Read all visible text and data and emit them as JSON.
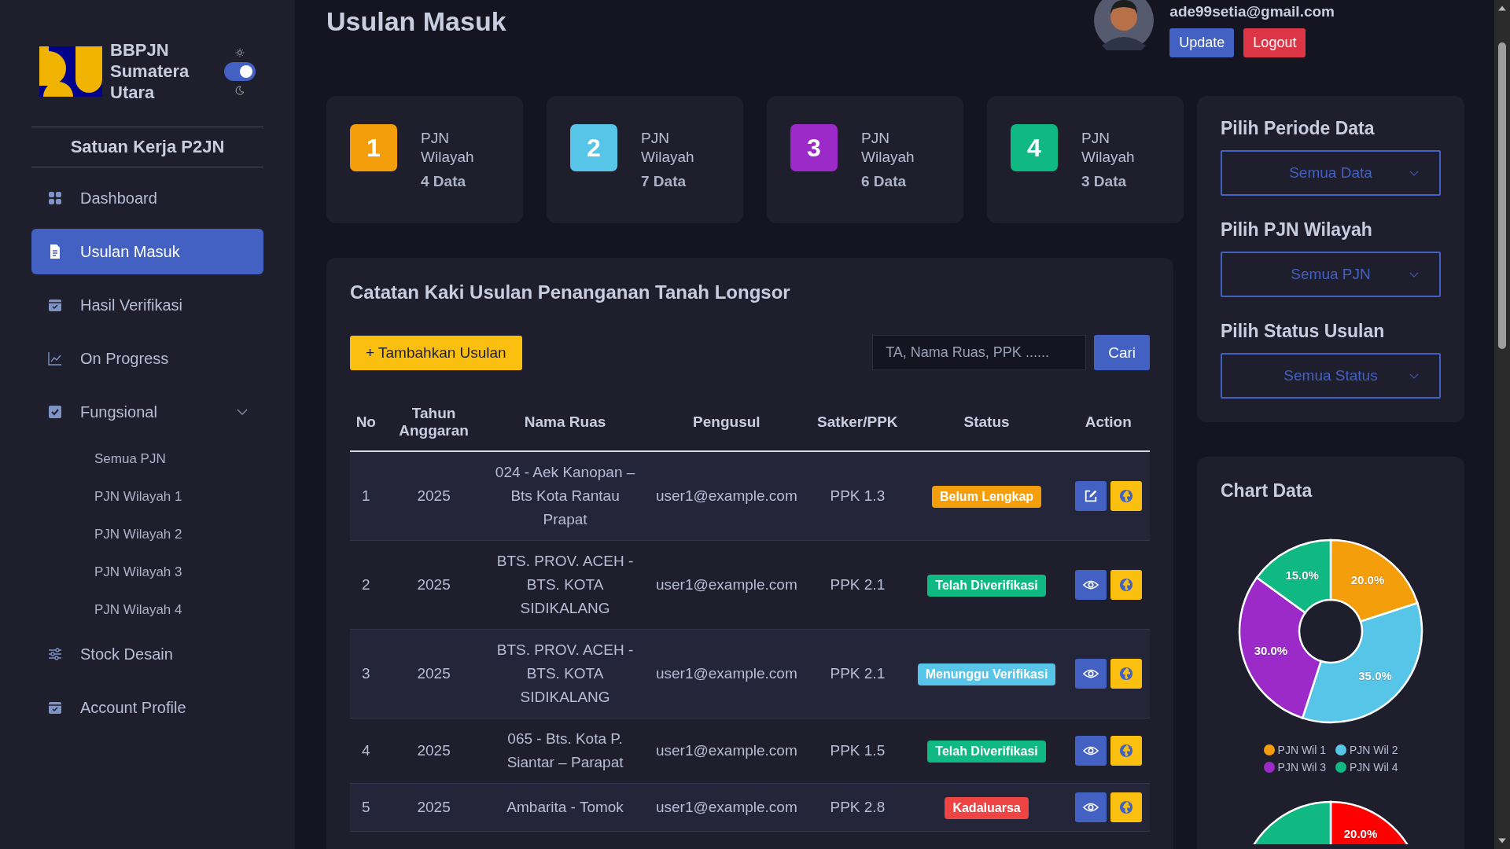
{
  "sidebar": {
    "brand": [
      "BBPJN",
      "Sumatera",
      "Utara"
    ],
    "dark_mode": true,
    "unit": "Satuan Kerja P2JN",
    "items": [
      {
        "label": "Dashboard",
        "kind": "grid",
        "selected": false
      },
      {
        "label": "Usulan Masuk",
        "kind": "doc",
        "selected": true
      },
      {
        "label": "Hasil Verifikasi",
        "kind": "calendar",
        "selected": false
      },
      {
        "label": "On Progress",
        "kind": "chart",
        "selected": false
      },
      {
        "label": "Fungsional",
        "kind": "check",
        "selected": false,
        "expanded": true,
        "children": [
          {
            "label": "Semua PJN"
          },
          {
            "label": "PJN Wilayah 1"
          },
          {
            "label": "PJN Wilayah 2"
          },
          {
            "label": "PJN Wilayah 3"
          },
          {
            "label": "PJN Wilayah 4"
          }
        ]
      },
      {
        "label": "Stock Desain",
        "kind": "sliders",
        "selected": false
      },
      {
        "label": "Account Profile",
        "kind": "calendar",
        "selected": false
      }
    ]
  },
  "page_title": "Usulan Masuk",
  "user": {
    "email": "ade99setia@gmail.com",
    "buttons": [
      {
        "label": "Update",
        "kind": "primary"
      },
      {
        "label": "Logout",
        "kind": "danger"
      }
    ]
  },
  "stats": [
    {
      "number": "1",
      "label": "PJN Wilayah",
      "count": "4 Data",
      "color": "#f59e0b"
    },
    {
      "number": "2",
      "label": "PJN Wilayah",
      "count": "7 Data",
      "color": "#56c5e8"
    },
    {
      "number": "3",
      "label": "PJN Wilayah",
      "count": "6 Data",
      "color": "#9b2ac9"
    },
    {
      "number": "4",
      "label": "PJN Wilayah",
      "count": "3 Data",
      "color": "#10b981"
    }
  ],
  "table": {
    "title": "Catatan Kaki Usulan Penanganan Tanah Longsor",
    "add_button": "+ Tambahkan Usulan",
    "search": {
      "placeholder": "TA, Nama Ruas, PPK ......",
      "button": "Cari"
    },
    "columns": [
      "No",
      "Tahun Anggaran",
      "Nama Ruas",
      "Pengusul",
      "Satker/PPK",
      "Status",
      "Action"
    ],
    "rows": [
      {
        "no": "1",
        "year": "2025",
        "road": "024 - Aek Kanopan – Bts Kota Rantau Prapat",
        "proposer": "user1@example.com",
        "ppk": "PPK 1.3",
        "status": {
          "label": "Belum Lengkap",
          "kind": "incomplete"
        },
        "actions": [
          {
            "kind": "edit"
          },
          {
            "kind": "globe"
          }
        ]
      },
      {
        "no": "2",
        "year": "2025",
        "road": "BTS. PROV. ACEH - BTS. KOTA SIDIKALANG",
        "proposer": "user1@example.com",
        "ppk": "PPK 2.1",
        "status": {
          "label": "Telah Diverifikasi",
          "kind": "verified"
        },
        "actions": [
          {
            "kind": "view"
          },
          {
            "kind": "globe"
          }
        ]
      },
      {
        "no": "3",
        "year": "2025",
        "road": "BTS. PROV. ACEH - BTS. KOTA SIDIKALANG",
        "proposer": "user1@example.com",
        "ppk": "PPK 2.1",
        "status": {
          "label": "Menunggu Verifikasi",
          "kind": "waiting"
        },
        "actions": [
          {
            "kind": "view"
          },
          {
            "kind": "globe"
          }
        ]
      },
      {
        "no": "4",
        "year": "2025",
        "road": "065 - Bts. Kota P. Siantar – Parapat",
        "proposer": "user1@example.com",
        "ppk": "PPK 1.5",
        "status": {
          "label": "Telah Diverifikasi",
          "kind": "verified"
        },
        "actions": [
          {
            "kind": "view"
          },
          {
            "kind": "globe"
          }
        ]
      },
      {
        "no": "5",
        "year": "2025",
        "road": "Ambarita - Tomok",
        "proposer": "user1@example.com",
        "ppk": "PPK 2.8",
        "status": {
          "label": "Kadaluarsa",
          "kind": "expired"
        },
        "actions": [
          {
            "kind": "view"
          },
          {
            "kind": "globe"
          }
        ]
      }
    ]
  },
  "filters": [
    {
      "title": "Pilih Periode Data",
      "value": "Semua Data"
    },
    {
      "title": "Pilih PJN Wilayah",
      "value": "Semua PJN"
    },
    {
      "title": "Pilih Status Usulan",
      "value": "Semua Status"
    }
  ],
  "chart_title": "Chart Data",
  "chart_data": {
    "type": "donut",
    "legend": "bottom",
    "categories": [
      "PJN Wil 1",
      "PJN Wil 2",
      "PJN Wil 3",
      "PJN Wil 4"
    ],
    "values": [
      20,
      35,
      30,
      15
    ],
    "colors": [
      "#f59e0b",
      "#56c5e8",
      "#9b2ac9",
      "#10b981"
    ],
    "value_labels": [
      "20.0%",
      "35.0%",
      "30.0%",
      "15.0%"
    ]
  },
  "second_chart_label": "20.0%"
}
